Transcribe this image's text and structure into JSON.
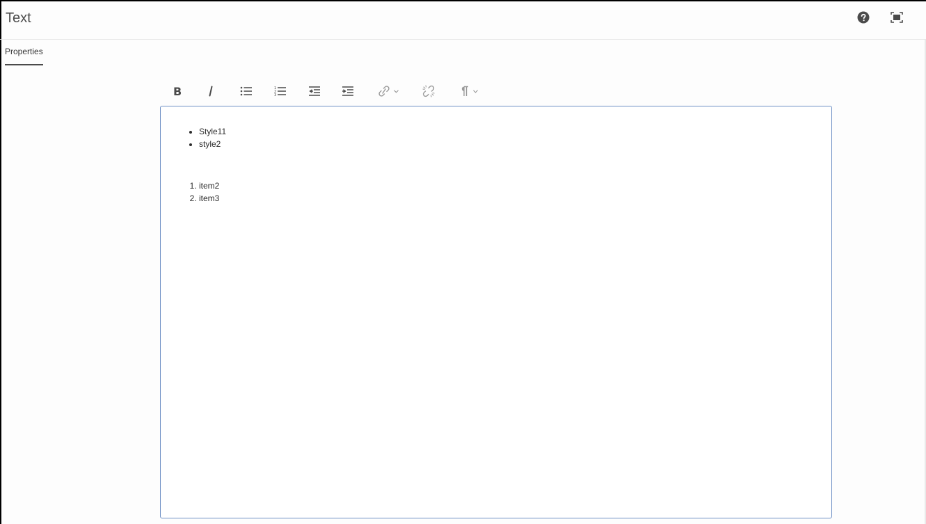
{
  "dialog": {
    "title": "Text"
  },
  "header": {
    "help_icon": "help-circle-icon",
    "fullscreen_icon": "fullscreen-icon"
  },
  "tabs": [
    {
      "label": "Properties",
      "active": true
    }
  ],
  "toolbar": {
    "buttons": [
      {
        "name": "bold",
        "icon": "bold-icon"
      },
      {
        "name": "italic",
        "icon": "italic-icon"
      },
      {
        "name": "bullet-list",
        "icon": "bullet-list-icon"
      },
      {
        "name": "numbered-list",
        "icon": "numbered-list-icon"
      },
      {
        "name": "outdent",
        "icon": "outdent-icon"
      },
      {
        "name": "indent",
        "icon": "indent-icon"
      },
      {
        "name": "link",
        "icon": "link-icon",
        "dropdown": true
      },
      {
        "name": "unlink",
        "icon": "unlink-icon"
      },
      {
        "name": "paragraph",
        "icon": "paragraph-icon",
        "dropdown": true
      }
    ]
  },
  "editor": {
    "bullet_items": [
      "Style11",
      "style2"
    ],
    "numbered_items": [
      "item2",
      "item3"
    ]
  },
  "colors": {
    "editor_border": "#6d8fc4",
    "icon": "#4b4b4b",
    "tab_underline": "#4b4b4b"
  }
}
